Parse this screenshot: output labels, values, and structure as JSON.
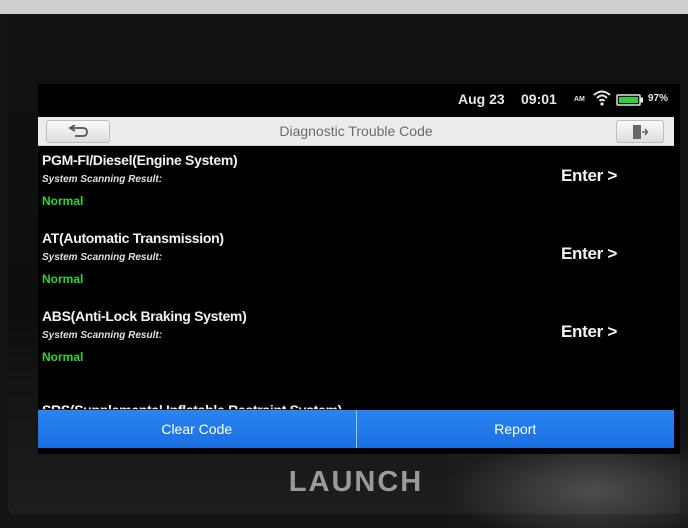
{
  "status_bar": {
    "date": "Aug 23",
    "time": "09:01",
    "am_pm": "AM",
    "battery": "97%",
    "wifi_icon": "wifi-icon",
    "battery_icon": "battery-icon"
  },
  "header": {
    "title": "Diagnostic Trouble Code",
    "back_icon": "back-arrow-icon",
    "exit_icon": "exit-icon"
  },
  "systems": [
    {
      "name": "PGM-FI/Diesel(Engine System)",
      "scan_label": "System Scanning Result:",
      "result": "Normal",
      "action": "Enter >"
    },
    {
      "name": "AT(Automatic Transmission)",
      "scan_label": "System Scanning Result:",
      "result": "Normal",
      "action": "Enter >"
    },
    {
      "name": "ABS(Anti-Lock Braking System)",
      "scan_label": "System Scanning Result:",
      "result": "Normal",
      "action": "Enter >"
    }
  ],
  "partial_system": {
    "name": "SRS(Supplemental Inflatable Restraint System)"
  },
  "actions": {
    "clear_code": "Clear Code",
    "report": "Report"
  },
  "brand": "LAUNCH",
  "colors": {
    "accent_blue": "#1f75e8",
    "normal_green": "#2ad43a",
    "screen_bg": "#000000",
    "title_bar_bg": "#ececec"
  }
}
